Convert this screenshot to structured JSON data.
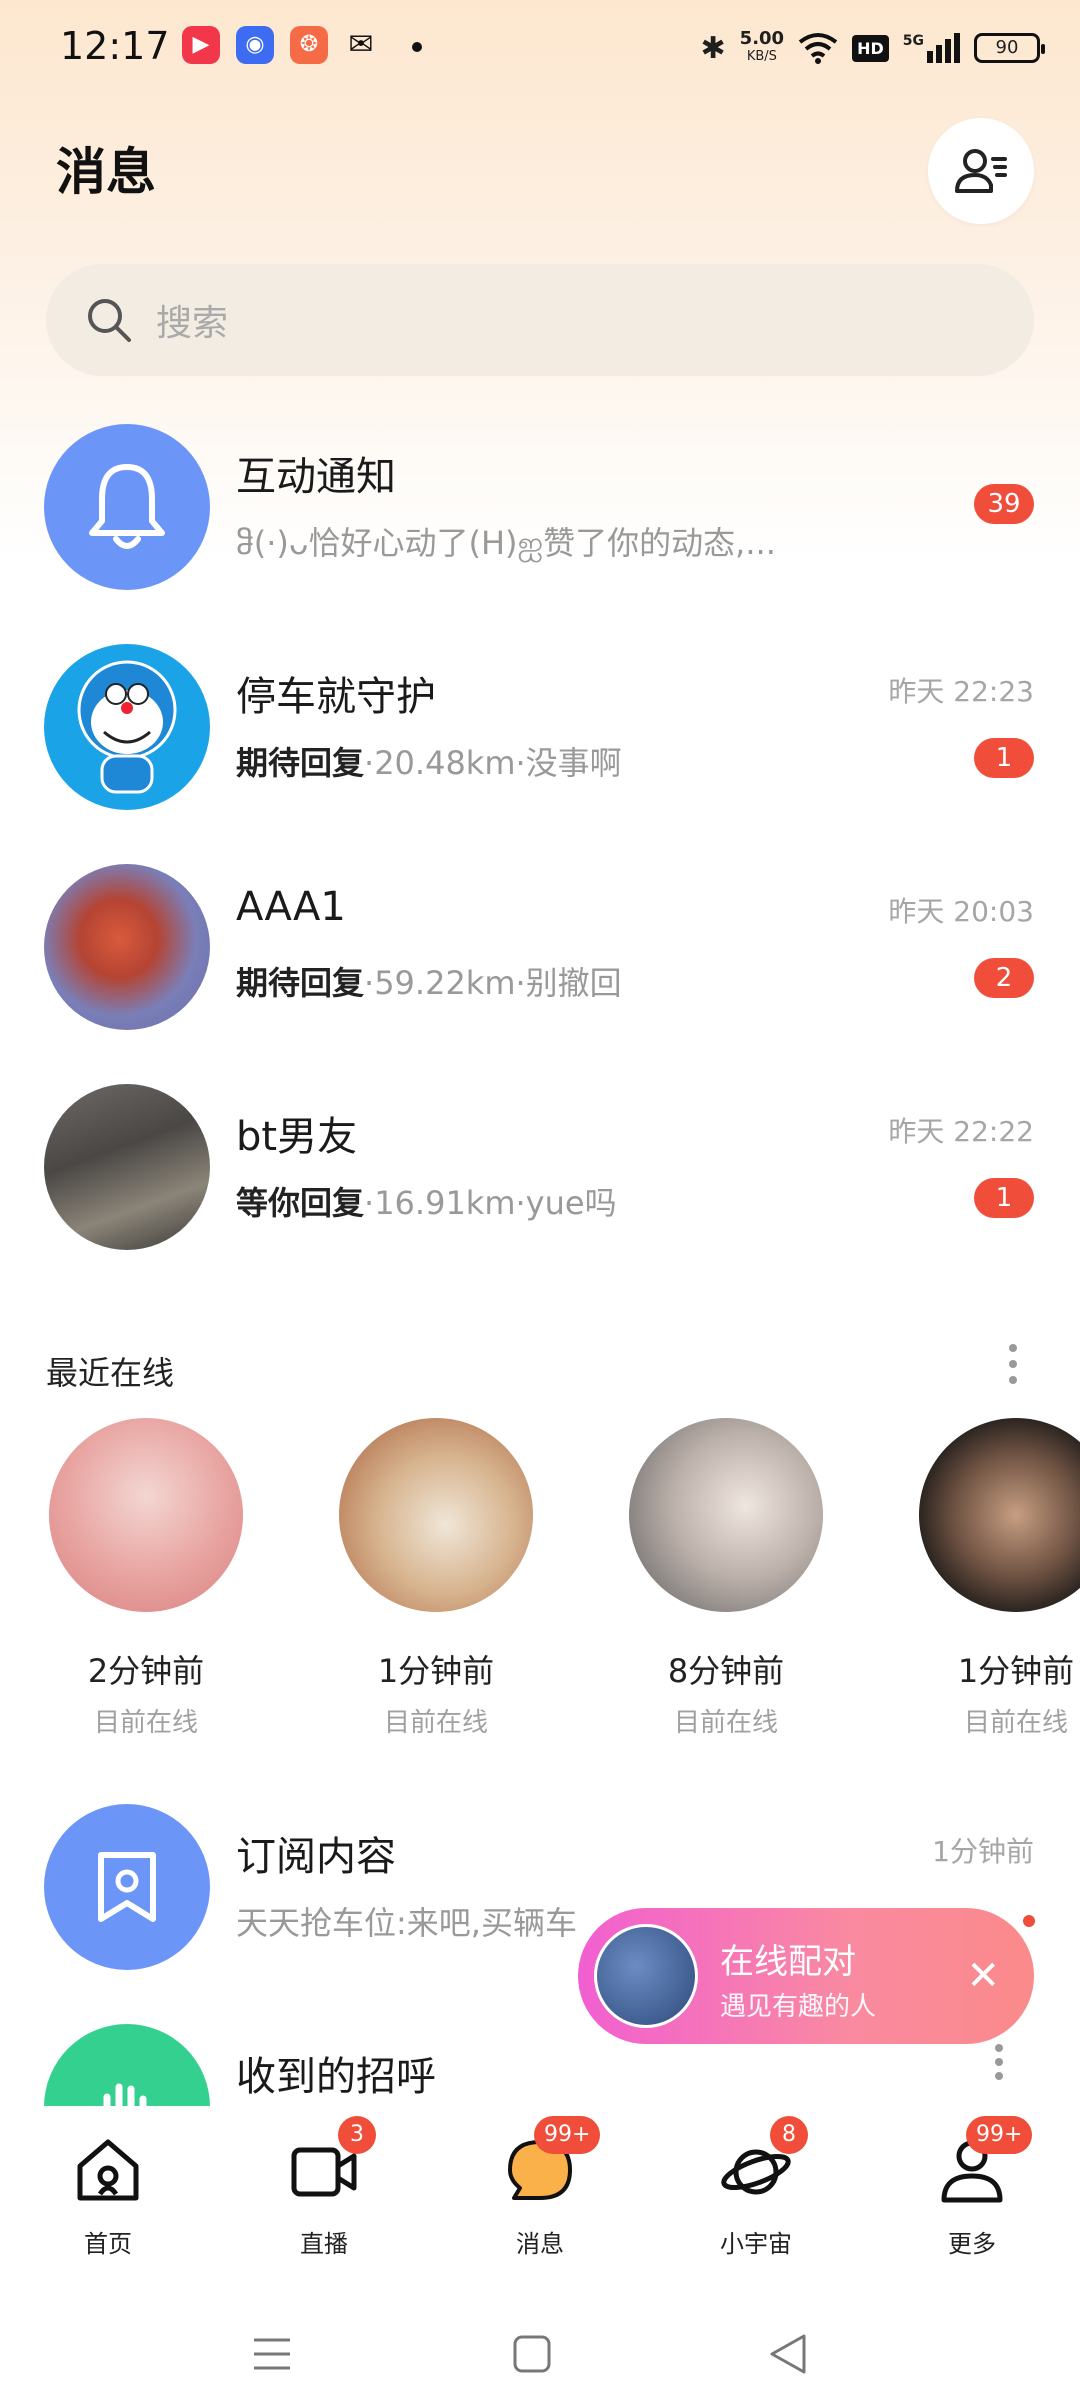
{
  "status_bar": {
    "time": "12:17",
    "net_speed": "5.00",
    "net_unit": "KB/S",
    "hd": "HD",
    "signal": "5G",
    "battery": "90"
  },
  "header": {
    "title": "消息",
    "search_placeholder": "搜索"
  },
  "messages": [
    {
      "name": "互动通知",
      "preview_plain": "ჵ(·)ᴗ恰好心动了(H)ஐ赞了你的动态,...",
      "badge": "39"
    },
    {
      "name": "停车就守护",
      "status": "期待回复",
      "distance": "·20.48km·",
      "text": "没事啊",
      "time": "昨天 22:23",
      "badge": "1"
    },
    {
      "name": "AAA1",
      "status": "期待回复",
      "distance": "·59.22km·",
      "text": "别撤回",
      "time": "昨天 20:03",
      "badge": "2"
    },
    {
      "name": "bt男友",
      "status": "等你回复",
      "distance": "·16.91km·",
      "text": "yue吗",
      "time": "昨天 22:22",
      "badge": "1"
    }
  ],
  "recent_online": {
    "title": "最近在线",
    "items": [
      {
        "time": "2分钟前",
        "status": "目前在线"
      },
      {
        "time": "1分钟前",
        "status": "目前在线"
      },
      {
        "time": "8分钟前",
        "status": "目前在线"
      },
      {
        "time": "1分钟前",
        "status": "目前在线"
      }
    ]
  },
  "subscription": {
    "name": "订阅内容",
    "preview": "天天抢车位:来吧,买辆车",
    "time": "1分钟前"
  },
  "greetings": {
    "name": "收到的招呼"
  },
  "float_match": {
    "title": "在线配对",
    "subtitle": "遇见有趣的人"
  },
  "bottom_nav": [
    {
      "label": "首页",
      "badge": ""
    },
    {
      "label": "直播",
      "badge": "3"
    },
    {
      "label": "消息",
      "badge": "99+"
    },
    {
      "label": "小宇宙",
      "badge": "8"
    },
    {
      "label": "更多",
      "badge": "99+"
    }
  ],
  "colors": {
    "accent_orange": "#fbb14a",
    "badge_red": "#f04d3a",
    "avatar_blue": "#6b95f7",
    "avatar_green": "#34d08f"
  }
}
